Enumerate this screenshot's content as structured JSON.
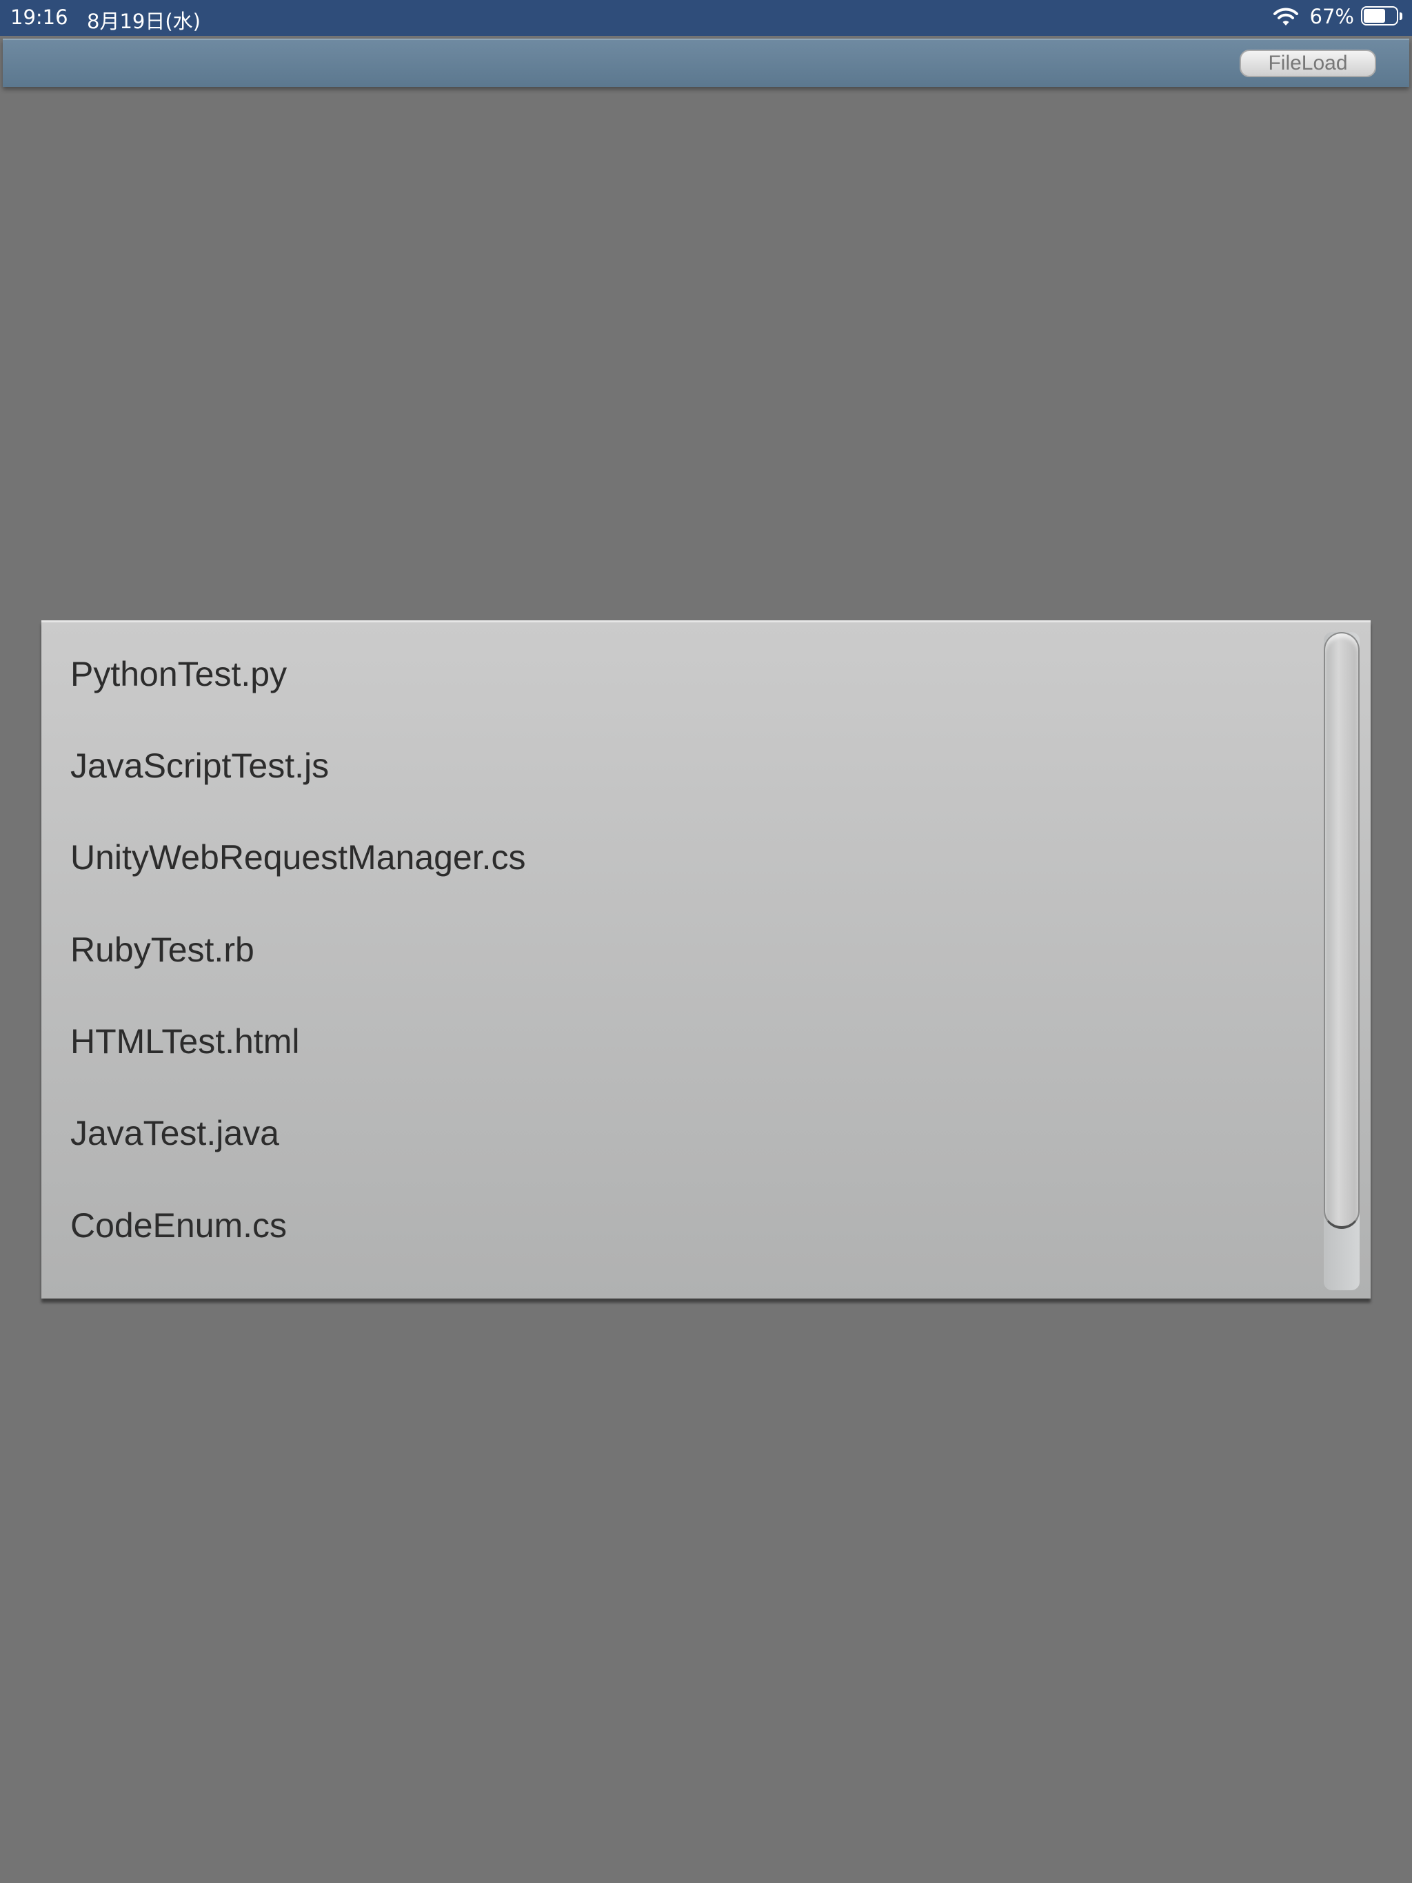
{
  "status_bar": {
    "time": "19:16",
    "date": "8月19日(水)",
    "wifi_icon": "wifi-icon",
    "battery_percent": "67%",
    "battery_level": 0.67,
    "battery_icon": "battery-icon"
  },
  "toolbar": {
    "fileload_label": "FileLoad"
  },
  "file_list": {
    "items": [
      "PythonTest.py",
      "JavaScriptTest.js",
      "UnityWebRequestManager.cs",
      "RubyTest.rb",
      "HTMLTest.html",
      "JavaTest.java",
      "CodeEnum.cs"
    ]
  },
  "colors": {
    "status_bar": "#2f4d7a",
    "toolbar": "#647f96",
    "background": "#747474",
    "panel": "#c0c0c0",
    "item_text": "#2c2c2c"
  }
}
